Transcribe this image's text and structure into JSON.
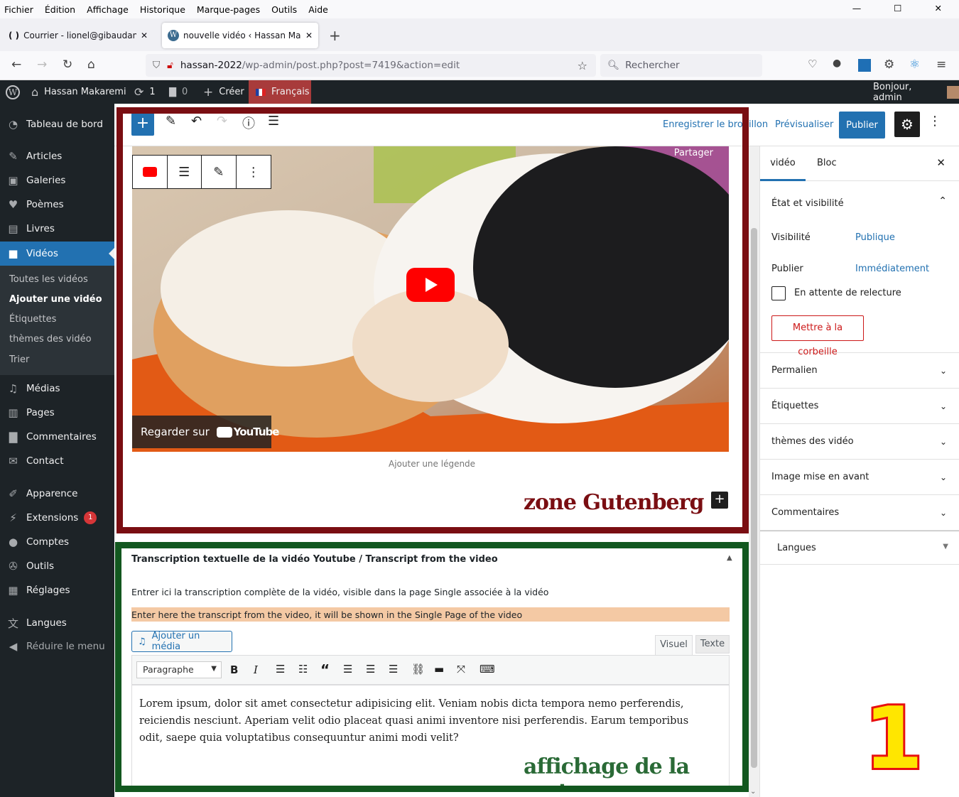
{
  "menubar": {
    "items": [
      "Fichier",
      "Édition",
      "Affichage",
      "Historique",
      "Marque-pages",
      "Outils",
      "Aide"
    ]
  },
  "window_controls": {
    "minimize": "—",
    "maximize": "☐",
    "close": "✕"
  },
  "tabs": [
    {
      "label": "Courrier - lionel@gibaudan.com",
      "icon": "( )"
    },
    {
      "label": "nouvelle vidéo ‹ Hassan Makaremi",
      "icon": "W"
    }
  ],
  "new_tab": "+",
  "address": {
    "host": "hassan-2022",
    "path": "/wp-admin/post.php?post=7419&action=edit"
  },
  "search": {
    "placeholder": "Rechercher"
  },
  "adminbar": {
    "site": "Hassan Makaremi",
    "updates": "1",
    "comments": "0",
    "create": "Créer",
    "language": "Français",
    "greeting": "Bonjour, admin"
  },
  "sidebar": {
    "items": [
      {
        "label": "Tableau de bord",
        "icon": "dashboard-icon"
      },
      {
        "label": "Articles",
        "icon": "pin-icon"
      },
      {
        "label": "Galeries",
        "icon": "gallery-icon"
      },
      {
        "label": "Poèmes",
        "icon": "heart-icon"
      },
      {
        "label": "Livres",
        "icon": "book-icon"
      },
      {
        "label": "Vidéos",
        "icon": "video-icon"
      },
      {
        "label": "Médias",
        "icon": "media-icon"
      },
      {
        "label": "Pages",
        "icon": "pages-icon"
      },
      {
        "label": "Commentaires",
        "icon": "comment-icon"
      },
      {
        "label": "Contact",
        "icon": "mail-icon"
      },
      {
        "label": "Apparence",
        "icon": "brush-icon"
      },
      {
        "label": "Extensions",
        "icon": "plugin-icon",
        "badge": "1"
      },
      {
        "label": "Comptes",
        "icon": "user-icon"
      },
      {
        "label": "Outils",
        "icon": "wrench-icon"
      },
      {
        "label": "Réglages",
        "icon": "settings-icon"
      },
      {
        "label": "Langues",
        "icon": "translate-icon"
      },
      {
        "label": "Réduire le menu",
        "icon": "collapse-icon"
      }
    ],
    "submenu": [
      "Toutes les vidéos",
      "Ajouter une vidéo",
      "Étiquettes",
      "thèmes des vidéo",
      "Trier"
    ]
  },
  "toolbar": {
    "save_draft": "Enregistrer le brouillon",
    "preview": "Prévisualiser",
    "publish": "Publier"
  },
  "video": {
    "share": "Partager",
    "watch_on": "Regarder sur",
    "youtube": "YouTube",
    "caption_placeholder": "Ajouter une légende"
  },
  "annotations": {
    "gutenberg": "zone Gutenberg",
    "meta": "affichage de la meta",
    "number": "1"
  },
  "metabox": {
    "title": "Transcription textuelle de la vidéo Youtube / Transcript from the video",
    "desc_fr": "Entrer ici la transcription complète de la vidéo, visible dans la page Single associée à la vidéo",
    "desc_en": "Enter here the transcript from the video, it will be shown in the Single Page of the video",
    "add_media": "Ajouter un média",
    "tab_visual": "Visuel",
    "tab_text": "Texte",
    "format": "Paragraphe",
    "content": "Lorem ipsum, dolor sit amet consectetur adipisicing elit. Veniam nobis dicta tempora nemo perferendis, reiciendis nesciunt. Aperiam velit odio placeat quasi animi inventore nisi perferendis. Earum temporibus odit, saepe quia voluptatibus consequuntur animi modi velit?"
  },
  "settings": {
    "tab_post": "vidéo",
    "tab_block": "Bloc",
    "status_title": "État et visibilité",
    "visibility_label": "Visibilité",
    "visibility_value": "Publique",
    "publish_label": "Publier",
    "publish_value": "Immédiatement",
    "pending": "En attente de relecture",
    "trash": "Mettre à la corbeille",
    "panels": [
      "Permalien",
      "Étiquettes",
      "thèmes des vidéo",
      "Image mise en avant",
      "Commentaires"
    ],
    "langues": "Langues"
  }
}
